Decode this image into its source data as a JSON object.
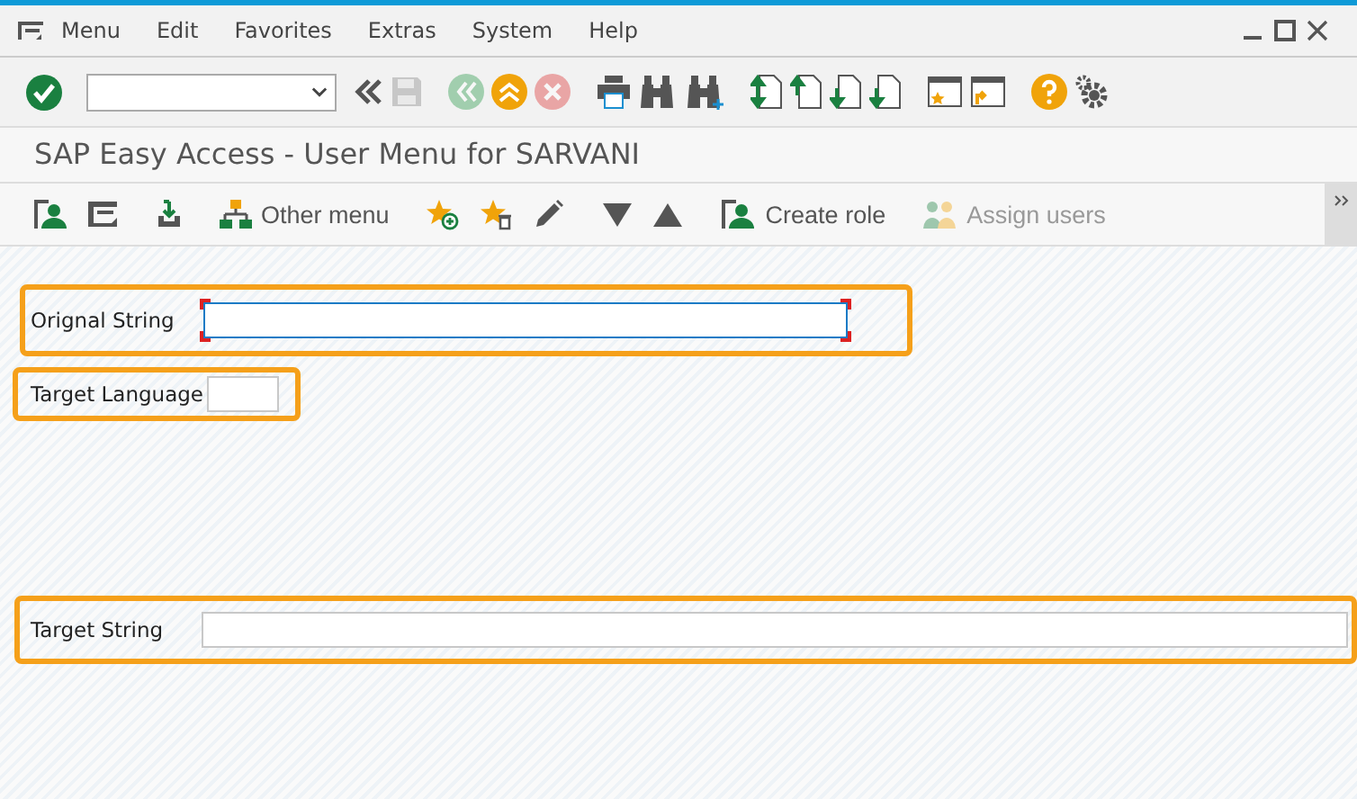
{
  "menu_bar": {
    "items": [
      "Menu",
      "Edit",
      "Favorites",
      "Extras",
      "System",
      "Help"
    ]
  },
  "system_toolbar": {
    "buttons": [
      {
        "kind": "back-double",
        "disabled": false
      },
      {
        "kind": "save",
        "disabled": true
      },
      {
        "kind": "back",
        "disabled": true
      },
      {
        "kind": "exit",
        "disabled": false
      },
      {
        "kind": "cancel",
        "disabled": true
      },
      {
        "kind": "print",
        "disabled": false
      },
      {
        "kind": "find",
        "disabled": false
      },
      {
        "kind": "find-next",
        "disabled": false
      },
      {
        "kind": "first-page",
        "disabled": false
      },
      {
        "kind": "prev-page",
        "disabled": false
      },
      {
        "kind": "next-page",
        "disabled": false
      },
      {
        "kind": "last-page",
        "disabled": false
      },
      {
        "kind": "new-session",
        "disabled": false
      },
      {
        "kind": "shortcut",
        "disabled": false
      },
      {
        "kind": "help",
        "disabled": false
      },
      {
        "kind": "settings",
        "disabled": false
      }
    ]
  },
  "screen_title": "SAP Easy Access  -  User Menu for SARVANI",
  "app_toolbar": [
    {
      "kind": "user-menu",
      "disabled": false
    },
    {
      "kind": "sap-menu",
      "disabled": false
    },
    {
      "kind": "download",
      "disabled": false
    },
    {
      "kind": "tree",
      "label": "Other menu",
      "disabled": false
    },
    {
      "kind": "add-favorite",
      "disabled": false
    },
    {
      "kind": "delete-favorite",
      "disabled": false
    },
    {
      "kind": "edit",
      "disabled": false
    },
    {
      "kind": "down",
      "disabled": false
    },
    {
      "kind": "up",
      "disabled": false
    },
    {
      "kind": "role",
      "label": "Create role",
      "disabled": false
    },
    {
      "kind": "users",
      "label": "Assign users",
      "disabled": true
    }
  ],
  "fields": [
    {
      "label": "Orignal String",
      "highlighted": true,
      "focused": true
    },
    {
      "label": "Target Language",
      "highlighted": true,
      "focused": false
    },
    {
      "label": "Target String",
      "highlighted": true,
      "focused": false
    }
  ]
}
